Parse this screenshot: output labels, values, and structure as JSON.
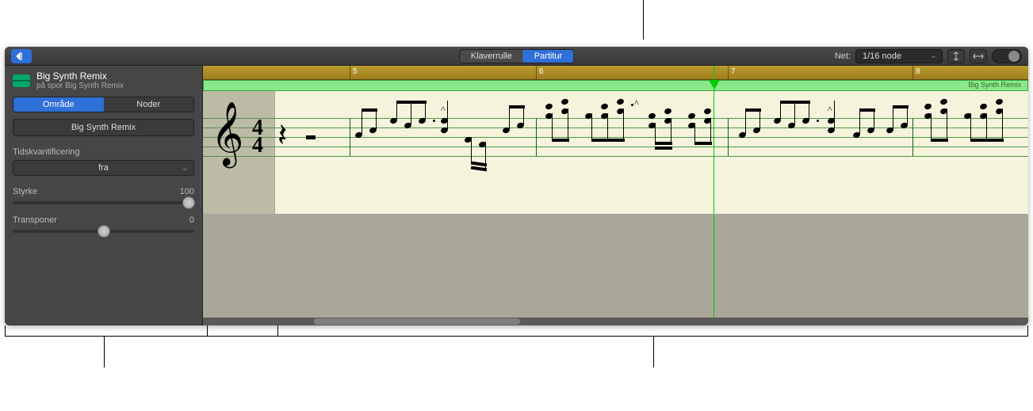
{
  "toolbar": {
    "view_piano_roll": "Klaverrulle",
    "view_score": "Partitur",
    "net_label": "Net:",
    "net_value": "1/16 node"
  },
  "inspector": {
    "region_title": "Big Synth Remix",
    "region_subtitle": "på spor Big Synth Remix",
    "tab_region": "Område",
    "tab_notes": "Noder",
    "region_name": "Big Synth Remix",
    "time_quantize_label": "Tidskvantificering",
    "time_quantize_value": "fra",
    "velocity_label": "Styrke",
    "velocity_value": "100",
    "transpose_label": "Transponer",
    "transpose_value": "0"
  },
  "ruler": {
    "bars": [
      "5",
      "6",
      "7",
      "8"
    ]
  },
  "region_bar_label": "Big Synth Remix",
  "chart_data": {
    "type": "score",
    "clef": "treble",
    "time_signature": "4/4",
    "bars_visible": [
      5,
      6,
      7,
      8
    ],
    "playhead_bar": 7,
    "notes_description": "Repeated rhythmic synth figure with sixteenth-note groups, accents and staccato marks, mostly on upper register (A4-D6 range). Pattern repeats per bar with slight variation."
  }
}
